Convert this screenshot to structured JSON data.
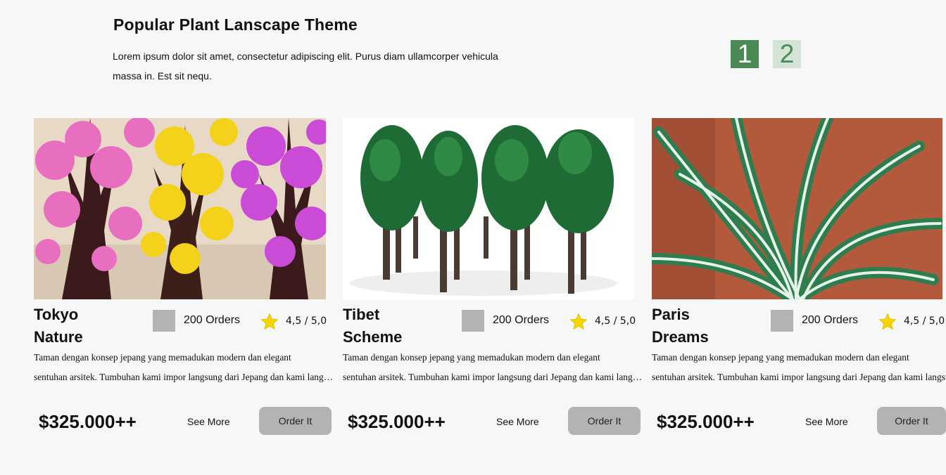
{
  "header": {
    "title": "Popular Plant Lanscape Theme",
    "description": "Lorem ipsum dolor sit amet, consectetur adipiscing elit. Purus diam ullamcorper vehicula massa in. Est sit nequ."
  },
  "pagination": {
    "pages": [
      "1",
      "2"
    ],
    "active_page": "1"
  },
  "cards": [
    {
      "name_line1": "Tokyo",
      "name_line2": "Nature",
      "orders": "200 Orders",
      "rating": "4,5 / 5,0",
      "desc_line1": "Taman dengan konsep jepang yang memadukan modern dan elegant",
      "desc_line2": "sentuhan arsitek. Tumbuhan kami impor langsung dari Jepang dan kami langsung",
      "price": "$325.000++",
      "see_more": "See More",
      "order_label": "Order It",
      "image": "blossom-trees-image"
    },
    {
      "name_line1": "Tibet",
      "name_line2": "Scheme",
      "orders": "200 Orders",
      "rating": "4,5 / 5,0",
      "desc_line1": "Taman dengan konsep jepang yang memadukan modern dan elegant",
      "desc_line2": "sentuhan arsitek. Tumbuhan kami impor langsung dari Jepang dan kami langsung",
      "price": "$325.000++",
      "see_more": "See More",
      "order_label": "Order It",
      "image": "green-trees-image"
    },
    {
      "name_line1": "Paris",
      "name_line2": "Dreams",
      "orders": "200 Orders",
      "rating": "4,5 / 5,0",
      "desc_line1": "Taman dengan konsep jepang yang memadukan modern dan elegant",
      "desc_line2": "sentuhan arsitek. Tumbuhan kami impor langsung dari Jepang dan kami langsung",
      "price": "$325.000++",
      "see_more": "See More",
      "order_label": "Order It",
      "image": "spider-plant-image"
    }
  ],
  "colors": {
    "accent": "#4a8a55",
    "accent_light": "#d3e4d6",
    "button_gray": "#b3b3b3",
    "star": "#f5d400"
  }
}
